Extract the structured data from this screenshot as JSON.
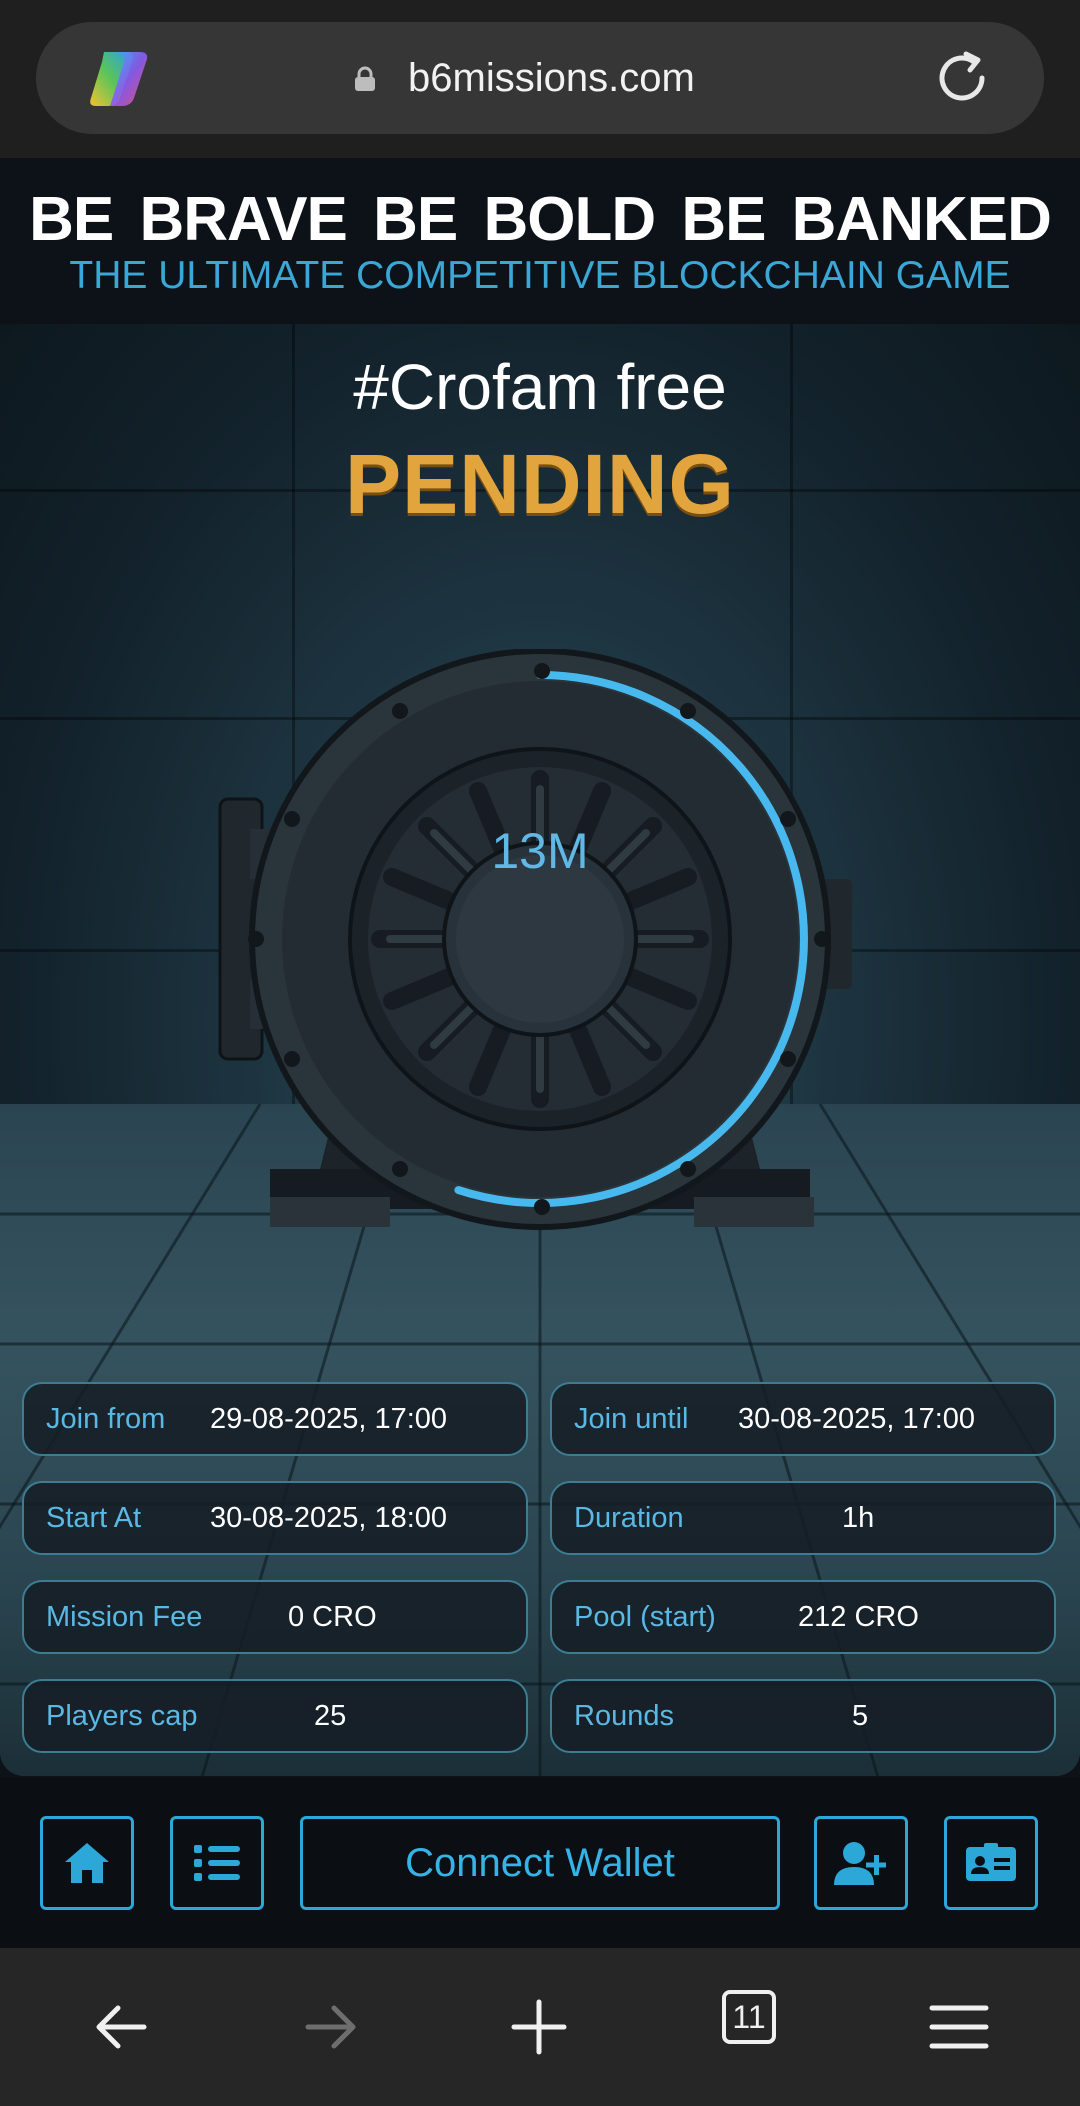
{
  "browser": {
    "url": "b6missions.com",
    "tab_count": "11"
  },
  "header": {
    "headline": "BE BRAVE  BE BOLD  BE BANKED",
    "tagline": "THE ULTIMATE COMPETITIVE BLOCKCHAIN GAME"
  },
  "mission": {
    "title": "#Crofam free",
    "status": "PENDING",
    "countdown": "13M",
    "countdown_progress": 0.55
  },
  "details": [
    {
      "label": "Join from",
      "value": "29-08-2025, 17:00"
    },
    {
      "label": "Join until",
      "value": "30-08-2025, 17:00"
    },
    {
      "label": "Start At",
      "value": "30-08-2025, 18:00"
    },
    {
      "label": "Duration",
      "value": "1h"
    },
    {
      "label": "Mission Fee",
      "value": "0 CRO"
    },
    {
      "label": "Pool (start)",
      "value": "212 CRO"
    },
    {
      "label": "Players cap",
      "value": "25"
    },
    {
      "label": "Rounds",
      "value": "5"
    }
  ],
  "actions": {
    "connect_label": "Connect Wallet",
    "icons": [
      "home-icon",
      "list-icon",
      "add-user-icon",
      "id-card-icon"
    ]
  },
  "colors": {
    "accent": "#2ba7d8",
    "status": "#e2a43c",
    "background": "#0d1218"
  }
}
